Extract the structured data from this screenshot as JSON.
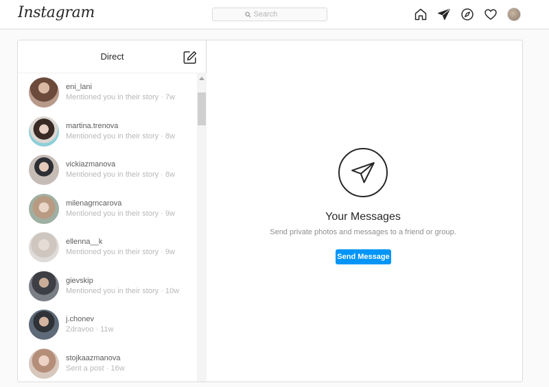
{
  "header": {
    "logo": "Instagram",
    "search_placeholder": "Search",
    "icons": [
      "home-icon",
      "direct-icon",
      "explore-icon",
      "activity-icon",
      "profile-avatar"
    ]
  },
  "inbox": {
    "title": "Direct",
    "threads": [
      {
        "username": "eni_lani",
        "preview": "Mentioned you in their story · 7w"
      },
      {
        "username": "martina.trenova",
        "preview": "Mentioned you in their story · 8w"
      },
      {
        "username": "vickiazmanova",
        "preview": "Mentioned you in their story · 8w"
      },
      {
        "username": "milenagrncarova",
        "preview": "Mentioned you in their story · 9w"
      },
      {
        "username": "ellenna__k",
        "preview": "Mentioned you in their story · 9w"
      },
      {
        "username": "gievskip",
        "preview": "Mentioned you in their story · 10w"
      },
      {
        "username": "j.chonev",
        "preview": "Zdravoo · 11w"
      },
      {
        "username": "stojkaazmanova",
        "preview": "Sent a post · 16w"
      }
    ]
  },
  "empty_state": {
    "title": "Your Messages",
    "subtitle": "Send private photos and messages to a friend or group.",
    "button_label": "Send Message"
  },
  "colors": {
    "accent": "#0095f6",
    "border": "#dbdbdb",
    "text": "#262626",
    "muted": "#8e8e8e"
  }
}
